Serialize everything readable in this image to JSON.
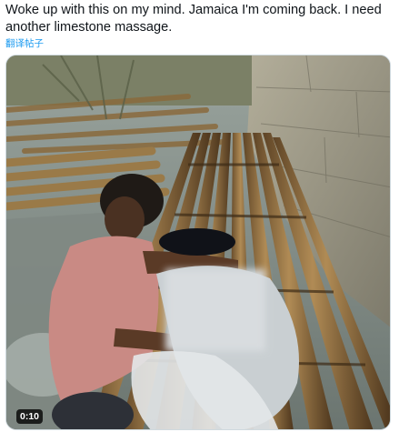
{
  "tweet": {
    "text": "Woke up with this on my mind. Jamaica I'm coming back. I need another limestone massage.",
    "translate_label": "翻译帖子"
  },
  "media": {
    "type": "video",
    "duration": "0:10",
    "content_icon": "video-thumbnail"
  },
  "colors": {
    "link": "#1d9bf0",
    "text": "#0f1419",
    "bamboo": "#8a6a3c",
    "water": "#7f8a86",
    "wall": "#a29f8e"
  }
}
